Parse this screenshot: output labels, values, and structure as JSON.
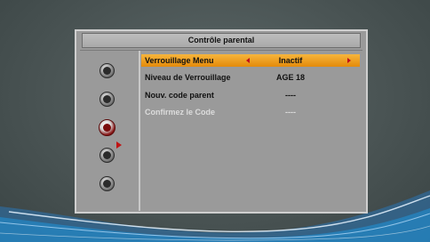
{
  "menu": {
    "title": "Contrôle parental"
  },
  "sidebar": {
    "icons": [
      {
        "name": "tv-screen-icon"
      },
      {
        "name": "gear-icon"
      },
      {
        "name": "wrench-icon",
        "active": true
      },
      {
        "name": "media-icon"
      },
      {
        "name": "film-reel-icon"
      }
    ]
  },
  "settings": [
    {
      "label": "Verrouillage Menu",
      "value": "Inactif",
      "selected": true
    },
    {
      "label": "Niveau de Verrouillage",
      "value": "AGE 18"
    },
    {
      "label": "Nouv. code parent",
      "value": "----"
    },
    {
      "label": "Confirmez le Code",
      "value": "----",
      "disabled": true
    }
  ],
  "colors": {
    "highlight": "#f0a020",
    "panel": "#9a9a9a",
    "background": "#4a5454",
    "active_icon": "#8a1818"
  }
}
